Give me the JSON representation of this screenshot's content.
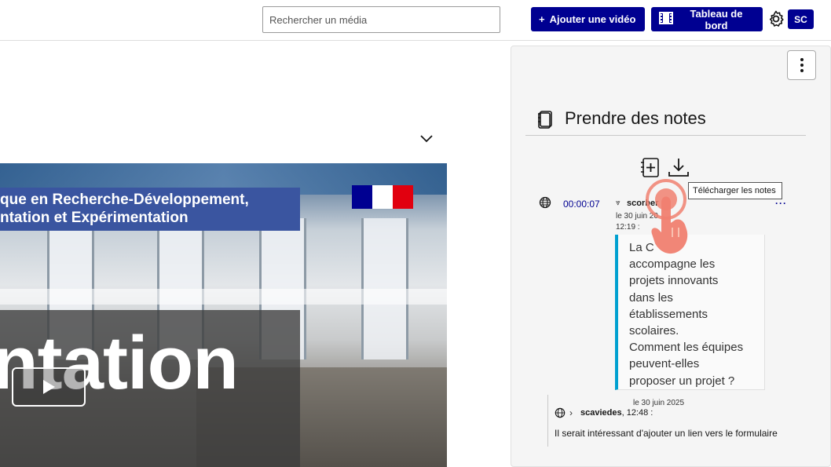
{
  "header": {
    "search_placeholder": "Rechercher un média",
    "add_video_label": "Ajouter une vidéo",
    "add_video_icon": "+",
    "dashboard_label": "Tableau de bord",
    "user_initials": "SC"
  },
  "video": {
    "banner_line1": "que en Recherche-Développement,",
    "banner_line2": "ntation et Expérimentation",
    "big_text": "ntation"
  },
  "notes": {
    "title": "Prendre des notes",
    "download_tooltip": "Télécharger les notes",
    "entries": [
      {
        "timestamp": "00:00:07",
        "author": "scorber",
        "date": "le 30 juin 20",
        "time": "12:19 :",
        "more": "···",
        "text": "La C... accompagne les projets innovants dans les établissements scolaires. Comment les équipes peuvent-elles proposer un projet ?",
        "text_lines": [
          "La C",
          "accompagne les",
          "projets innovants",
          "dans les",
          "établissements",
          "scolaires.",
          "Comment les équipes",
          "peuvent-elles",
          "proposer un projet ?"
        ]
      }
    ],
    "replies": [
      {
        "date": "le 30 juin 2025",
        "author": "scaviedes",
        "time": ", 12:48 :",
        "text": "Il serait intéressant d'ajouter un lien vers le formulaire"
      }
    ]
  },
  "colors": {
    "primary": "#000091",
    "note_accent": "#00a0d0",
    "flag_blue": "#000091",
    "flag_red": "#e1000f"
  }
}
